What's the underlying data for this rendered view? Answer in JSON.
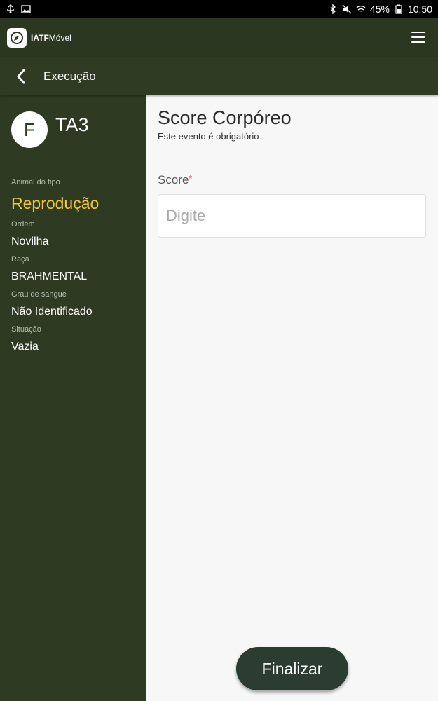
{
  "status_bar": {
    "battery": "45%",
    "time": "10:50",
    "icons": [
      "usb-icon",
      "image-icon",
      "bluetooth-icon",
      "mute-icon",
      "wifi-icon",
      "battery-icon"
    ]
  },
  "app_bar": {
    "logo_bold": "IATF",
    "logo_light": "Móvel",
    "icons": [
      "compass-icon",
      "menu-icon"
    ]
  },
  "sub_bar": {
    "title": "Execução",
    "icons": [
      "back-icon"
    ]
  },
  "sidebar": {
    "avatar_letter": "F",
    "animal_id": "TA3",
    "fields": [
      {
        "label": "Animal do tipo",
        "value": "Reprodução"
      },
      {
        "label": "Ordem",
        "value": "Novilha"
      },
      {
        "label": "Raça",
        "value": "BRAHMENTAL"
      },
      {
        "label": "Grau de sangue",
        "value": "Não Identificado"
      },
      {
        "label": "Situação",
        "value": "Vazia"
      }
    ]
  },
  "main": {
    "heading": "Score Corpóreo",
    "subtitle": "Este evento é obrigatório",
    "score_label": "Score",
    "required_mark": "*",
    "score_value": "",
    "score_placeholder": "Digite",
    "finalize_label": "Finalizar"
  },
  "colors": {
    "header": "#2b3720",
    "sidebar": "#2f3a22",
    "highlight": "#f1c832",
    "button": "#2b3d30",
    "background": "#f7f7f8"
  }
}
